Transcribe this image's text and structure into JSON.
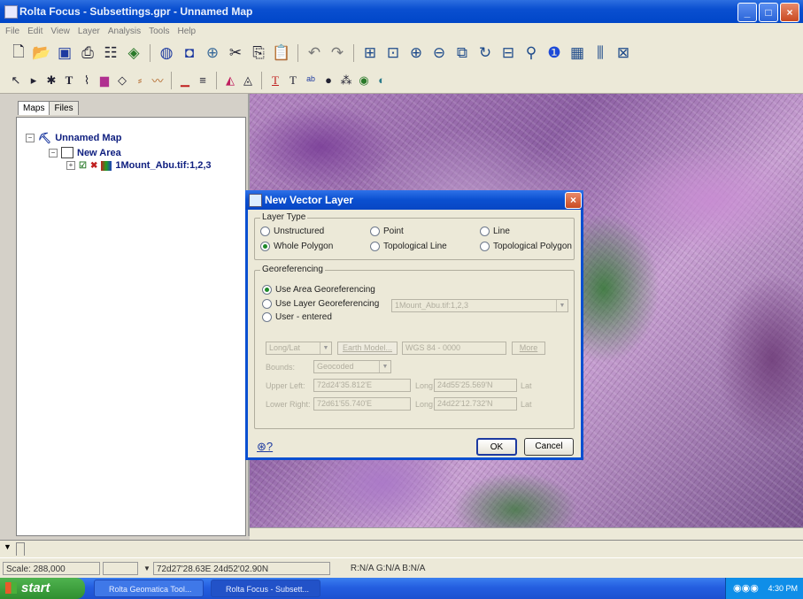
{
  "window": {
    "title": "Rolta Focus - Subsettings.gpr - Unnamed Map"
  },
  "menu": [
    "File",
    "Edit",
    "View",
    "Layer",
    "Analysis",
    "Tools",
    "Help"
  ],
  "left_panel": {
    "tabs": [
      "Maps",
      "Files"
    ],
    "tree": {
      "map": "Unnamed Map",
      "area": "New Area",
      "layer": "1Mount_Abu.tif:1,2,3"
    }
  },
  "dialog": {
    "title": "New Vector Layer",
    "layer_type": {
      "label": "Layer Type",
      "options": [
        "Unstructured",
        "Point",
        "Line",
        "Whole Polygon",
        "Topological Line",
        "Topological Polygon"
      ],
      "selected": "Whole Polygon"
    },
    "georef": {
      "label": "Georeferencing",
      "options": [
        "Use Area Georeferencing",
        "Use Layer Georeferencing",
        "User - entered"
      ],
      "selected": "Use Area Georeferencing",
      "layer_dropdown": "1Mount_Abu.tif:1,2,3",
      "proj": "Long/Lat",
      "earth_model_btn": "Earth Model...",
      "earth_model": "WGS 84 - 0000",
      "more_btn": "More",
      "bounds_label": "Bounds:",
      "bounds_value": "Geocoded",
      "upper_left_label": "Upper Left:",
      "upper_left_long": "72d24'35.812'E",
      "upper_left_lat": "24d55'25.569'N",
      "lower_right_label": "Lower Right:",
      "lower_right_long": "72d61'55.740'E",
      "lower_right_lat": "24d22'12.732'N",
      "long_label": "Long",
      "lat_label": "Lat"
    },
    "ok": "OK",
    "cancel": "Cancel"
  },
  "status": {
    "scale": "Scale: 288,000",
    "coords": "72d27'28.63E 24d52'02.90N",
    "rgb": "R:N/A G:N/A B:N/A"
  },
  "taskbar": {
    "start": "start",
    "items": [
      "Rolta Geomatica Tool...",
      "Rolta Focus - Subsett..."
    ],
    "clock": "4:30 PM"
  }
}
